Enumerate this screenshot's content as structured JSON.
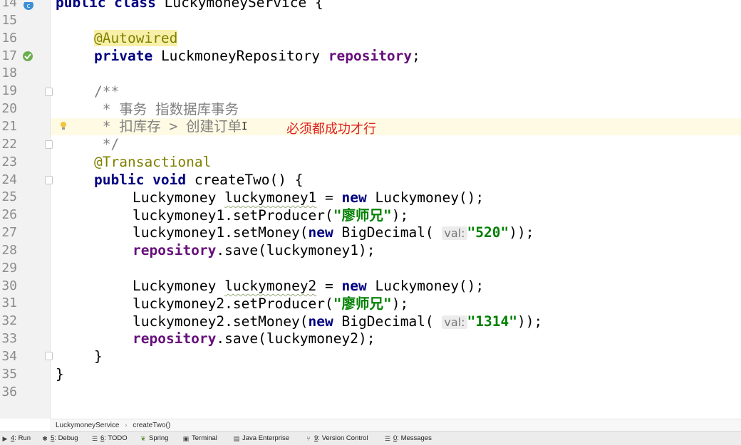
{
  "editor": {
    "line_numbers": [
      "14",
      "15",
      "16",
      "17",
      "18",
      "19",
      "20",
      "21",
      "22",
      "23",
      "24",
      "25",
      "26",
      "27",
      "28",
      "29",
      "30",
      "31",
      "32",
      "33",
      "34",
      "35",
      "36"
    ],
    "lines": {
      "l14": {
        "kw": "public class",
        "name": "LuckymoneyService {"
      },
      "l16": {
        "ann": "@Autowired"
      },
      "l17": {
        "kw": "private",
        "type": "LuckmoneyRepository",
        "field": "repository",
        "end": ";"
      },
      "l19": {
        "cmt": "/**"
      },
      "l20": {
        "cmt": " * 事务 指数据库事务"
      },
      "l21": {
        "cmt": " * 扣库存 > 创建订单"
      },
      "l22": {
        "cmt": " */"
      },
      "l23": {
        "ann": "@Transactional"
      },
      "l24": {
        "kw": "public void",
        "rest": "createTwo() {"
      },
      "l25": {
        "type": "Luckymoney",
        "var": "luckymoney1",
        "eq": "=",
        "kw": "new",
        "rest": "Luckymoney();"
      },
      "l26": {
        "call": "luckymoney1.setProducer(",
        "str": "\"廖师兄\"",
        "end": ");"
      },
      "l27": {
        "call": "luckymoney1.setMoney(",
        "kw": "new",
        "cls": "BigDecimal(",
        "hint": "val:",
        "str": "\"520\"",
        "end": "));"
      },
      "l28": {
        "field": "repository",
        "rest": ".save(luckymoney1);"
      },
      "l30": {
        "type": "Luckymoney",
        "var": "luckymoney2",
        "eq": "=",
        "kw": "new",
        "rest": "Luckymoney();"
      },
      "l31": {
        "call": "luckymoney2.setProducer(",
        "str": "\"廖师兄\"",
        "end": ");"
      },
      "l32": {
        "call": "luckymoney2.setMoney(",
        "kw": "new",
        "cls": "BigDecimal(",
        "hint": "val:",
        "str": "\"1314\"",
        "end": "));"
      },
      "l33": {
        "field": "repository",
        "rest": ".save(luckymoney2);"
      },
      "l34": {
        "rest": "}"
      },
      "l35": {
        "rest": "}"
      }
    },
    "annotation_note": "必须都成功才行",
    "cursor_glyph": "I"
  },
  "breadcrumb": {
    "class_name": "LuckymoneyService",
    "separator": "›",
    "method_name": "createTwo()"
  },
  "toolbar": {
    "run": {
      "num": "4",
      "label": ": Run"
    },
    "debug": {
      "num": "5",
      "label": ": Debug"
    },
    "todo": {
      "num": "6",
      "label": ": TODO"
    },
    "spring": {
      "label": "Spring"
    },
    "terminal": {
      "label": "Terminal"
    },
    "java_enterprise": {
      "label": "Java Enterprise"
    },
    "version_control": {
      "num": "9",
      "label": ": Version Control"
    },
    "messages": {
      "num": "0",
      "label": ": Messages"
    }
  },
  "colors": {
    "keyword": "#000080",
    "annotation": "#808000",
    "field": "#660e7a",
    "string": "#008000",
    "comment": "#808080",
    "note": "#e02020"
  }
}
